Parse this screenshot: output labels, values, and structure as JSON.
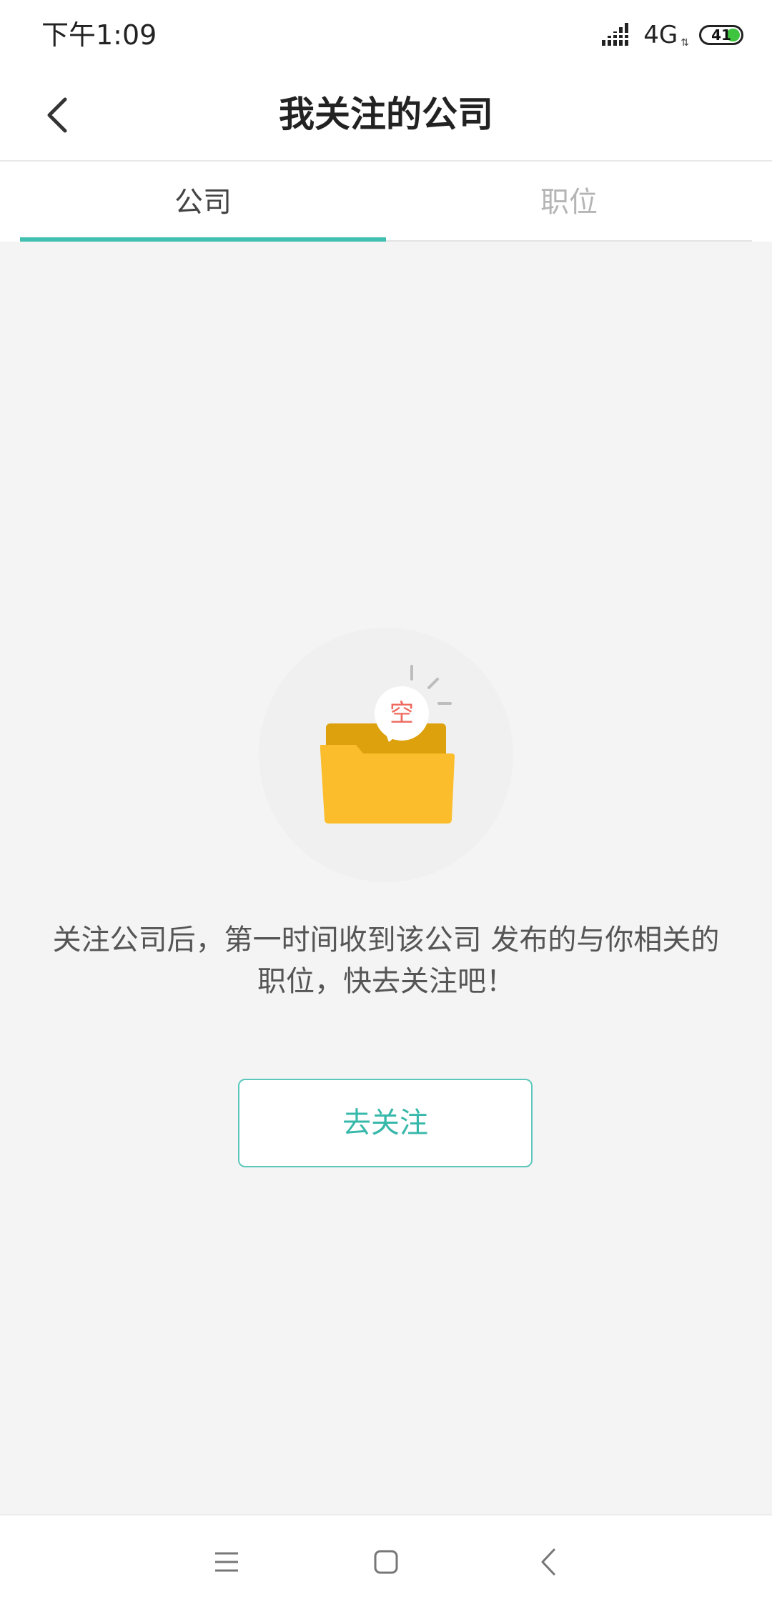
{
  "status_bar": {
    "time": "下午1:09",
    "network": "4G",
    "network_sub": "⇅",
    "battery": "41",
    "battery_color": "#3fc43f"
  },
  "header": {
    "title": "我关注的公司",
    "back_icon": "chevron-left-icon"
  },
  "tabs": [
    {
      "label": "公司",
      "active": true
    },
    {
      "label": "职位",
      "active": false
    }
  ],
  "accent_color": "#41bfb0",
  "empty_state": {
    "illustration": "empty-folder-icon",
    "badge_text": "空",
    "message_line1": "关注公司后，第一时间收到该公司 发布的与你相关的",
    "message_line2": "职位，快去关注吧！",
    "button_label": "去关注"
  },
  "nav_bar": {
    "items": [
      "menu-icon",
      "home-icon",
      "back-icon"
    ]
  }
}
